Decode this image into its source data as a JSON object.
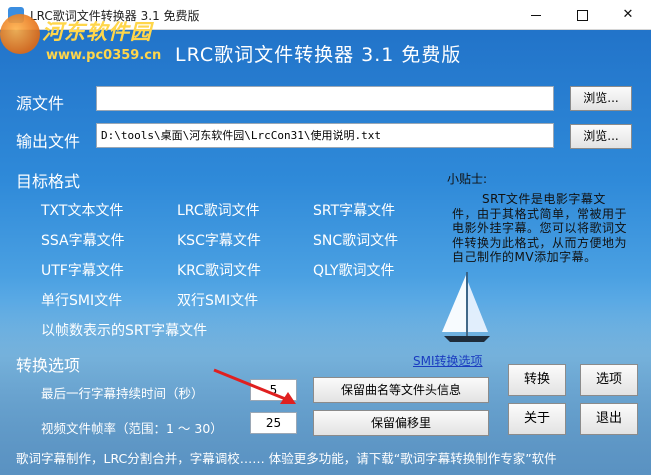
{
  "window": {
    "title": "LRC歌词文件转换器 3.1 免费版",
    "controls": {
      "minimize": "—",
      "maximize": "☐",
      "close": "✕"
    }
  },
  "watermark": {
    "site_name": "河东软件园",
    "url": "www.pc0359.cn"
  },
  "header": {
    "title": "LRC歌词文件转换器  3.1  免费版"
  },
  "source": {
    "label": "源文件",
    "value": "",
    "browse_label": "浏览..."
  },
  "output": {
    "label": "输出文件",
    "value": "D:\\tools\\桌面\\河东软件园\\LrcCon31\\使用说明.txt",
    "browse_label": "浏览..."
  },
  "target_format": {
    "heading": "目标格式",
    "formats": [
      "TXT文本文件",
      "LRC歌词文件",
      "SRT字幕文件",
      "SSA字幕文件",
      "KSC字幕文件",
      "SNC歌词文件",
      "UTF字幕文件",
      "KRC歌词文件",
      "QLY歌词文件",
      "单行SMI文件",
      "双行SMI文件",
      "以帧数表示的SRT字幕文件"
    ]
  },
  "tips": {
    "heading": "小贴士:",
    "body": "SRT文件是电影字幕文件，由于其格式简单，常被用于电影外挂字幕。您可以将歌词文件转换为此格式，从而方便地为自己制作的MV添加字幕。"
  },
  "options": {
    "heading": "转换选项",
    "smi_link": "SMI转换选项",
    "last_line_label": "最后一行字幕持续时间（秒）",
    "last_line_value": "5",
    "frame_rate_label": "视频文件帧率（范围：1 ～ 30）",
    "frame_rate_value": "25",
    "keep_header_button": "保留曲名等文件头信息",
    "keep_offset_button": "保留偏移里"
  },
  "actions": {
    "convert": "转换",
    "options": "选项",
    "about": "关于",
    "exit": "退出"
  },
  "status_bar": {
    "text": "歌词字幕制作，LRC分割合并，字幕调校…… 体验更多功能，请下载“歌词字幕转换制作专家”软件"
  }
}
